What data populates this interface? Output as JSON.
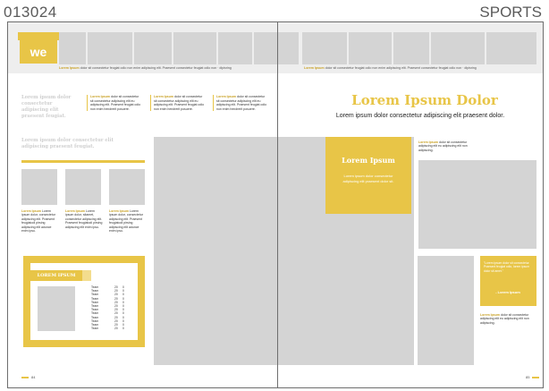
{
  "header": {
    "code": "013024",
    "section": "SPORTS"
  },
  "banner": {
    "logo": "we",
    "ticker_left_bold": "Lorem Ipsum",
    "ticker_left": " dolor sit consectetur feugiat odio non enim adipiscing elit. Praesent consectetur feugiat odio non · dipisring",
    "ticker_right_bold": "Lorem Ipsum",
    "ticker_right": " dolor sit consectetur feugiat odio non enim adipiscing elit. Praesent consectetur feugiat odio non · dipisring"
  },
  "left_page": {
    "ghost_intro": "Lorem ipsum dolor consectetur adipiscing elit praesent feugiat.",
    "ghost_sub": "Lorem ipsum dolor consectetur elit adipiscing praesent feugiat.",
    "columns": [
      {
        "bold": "Lorem Ipsum",
        "text": " dolor sit consectetur sit consectetur adipiscing elit eu adipiscing elit. Praesent feugiat odio non enim hendrerit posuere."
      },
      {
        "bold": "Lorem Ipsum",
        "text": " dolor sit consectetur sit consectetur adipiscing elit eu adipiscing elit. Praesent feugiat odio non enim hendrerit posuere."
      },
      {
        "bold": "Lorem Ipsum",
        "text": " dolor sit consectetur sit consectetur adipiscing elit eu adipiscing elit. Praesent feugiat odio non enim hendrerit posuere."
      }
    ],
    "captions": [
      {
        "bold": "Lorem Ipsum",
        "text": " Lorem ipsum dolor, consectetur adipiscing elit. Praesent feugiatodi pirsing adipiscing elit adunce enim ipsu."
      },
      {
        "bold": "Lorem Ipsum",
        "text": " Lorem ipsum dolor, sitamet, consectetur adipiscing elit. Praesent feugiatodi pirsing adipiscing elit enim ipsu."
      },
      {
        "bold": "Lorem Ipsum",
        "text": " Lorem ipsum dolor, consectetur adipiscing elit. Praesent feugiatodi pirsing adipiscing elit adunce enim ipsu."
      }
    ],
    "box_title": "LOREM IPSUM",
    "scores": [
      [
        "Team",
        "20",
        "0"
      ],
      [
        "Team",
        "20",
        "0"
      ],
      [
        "Team",
        "20",
        "0"
      ],
      [
        "Team",
        "20",
        "0"
      ],
      [
        "Team",
        "20",
        "0"
      ],
      [
        "Team",
        "20",
        "0"
      ],
      [
        "Team",
        "20",
        "0"
      ],
      [
        "Team",
        "20",
        "0"
      ],
      [
        "Team",
        "20",
        "0"
      ],
      [
        "Team",
        "20",
        "0"
      ],
      [
        "Team",
        "20",
        "0"
      ],
      [
        "Team",
        "20",
        "0"
      ]
    ],
    "page_number": "84"
  },
  "right_page": {
    "headline": "Lorem Ipsum Dolor",
    "subheadline": "Lorem ipsum dolor consectetur adipiscing elit praesent dolor.",
    "yellow_title": "Lorem Ipsum",
    "yellow_text": "Lorem ipsum dolor consectetur adipiscing elit praesent dolor sit.",
    "side_note_bold": "Lorem Ipsum",
    "side_note": " dolor sit consectetur adipiscing elit eu adipiscing elit non adipiscing.",
    "quote_text": "\"Lorem ipsum dolor sit consectetur. Praesent feugiat odio, lorem ipsum dolor sit amet.\"",
    "quote_author": "- Lorem Ipsum",
    "bottom_note_bold": "Lorem Ipsum",
    "bottom_note": " dolor sit consectetur adipiscing elit eu adipiscing elit non adipiscing.",
    "page_number": "85"
  },
  "colors": {
    "accent": "#e8c547",
    "placeholder": "#d4d4d4",
    "band": "#eeeeee"
  }
}
